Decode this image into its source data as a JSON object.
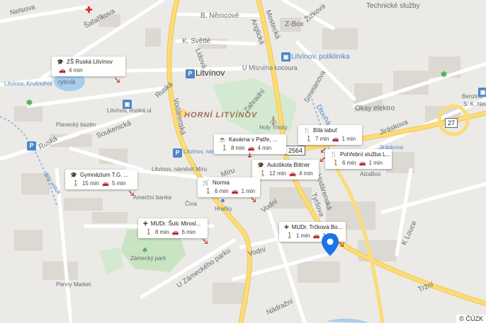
{
  "labels": {
    "nelsova": "Nelsova",
    "safarikova": "Šafaříkova",
    "b_nemcove": "B. Němcové",
    "k_svetle": "K. Světlé",
    "mostecka": "Mostecká",
    "zizkova": "Žižkova",
    "z_box": "Z-Box",
    "technicke_sluzby": "Technické služby",
    "anglicka": "Anglická",
    "litvinov_poliklinika": "Litvínov, poliklinika",
    "u_mlsneho_kocoura": "U Mlsného kocoura",
    "litvinov": "Litvínov",
    "lidova": "Lidová",
    "litvinov_krusnohor": "Litvínov, Krušnohor",
    "rybnik": "rybník",
    "ruska_1": "Ruská",
    "vodarenska_1": "Vodárenská",
    "zahradni": "Zahradní",
    "smetanova": "Smetanova",
    "okay_elektro": "Okay elektro",
    "benzina": "Benzina -",
    "s_k_neum": "S. K. Neum",
    "dlouha": "Dlouhá",
    "litvinov_ruska": "Litvínov, Ruská ul.",
    "plavecky_bazen": "Plavecký bazén",
    "soukenicka": "Soukenická",
    "horni_litvinov": "HORNÍ LITVÍNOV",
    "holy_trinity": "Holy Trinity",
    "jiraskova": "Jiráskova",
    "ruska_2": "Ruská",
    "litvinov_nam": "Litvínov, nám",
    "litvinov_namesti_miru": "Litvínov, náměstí Míru",
    "miru": "Míru",
    "jiraskova_2": "Jiráskova",
    "alzabox": "AlzaBox",
    "ke_potok": "Bílý potok",
    "americni_banka": "Amerční banka",
    "cina": "Čína",
    "hracky": "Hračky",
    "vodni_1": "Vodní",
    "vodarenska_2": "Vodárenská",
    "tyrsova": "Tyršova",
    "k_louce": "K Louce",
    "zamecky_park": "Zámecký park",
    "u_zameckeho_parku": "U Zámeckého parku",
    "vodni_2": "Vodní",
    "penny_market": "Penny Market",
    "nadrazni": "Nádražní",
    "trzni": "Tržní"
  },
  "roads": {
    "r2564": "2564",
    "r27": "27"
  },
  "cards": [
    {
      "title": "ZŠ Ruská Litvínov",
      "icon": "school-icon",
      "walk": "",
      "drive": "4 min"
    },
    {
      "title": "Kavárna v Patře, ...",
      "icon": "cafe-icon",
      "walk": "8 min",
      "drive": "4 min"
    },
    {
      "title": "Bílá labuť",
      "icon": "restaurant-icon",
      "walk": "7 min",
      "drive": "1 min"
    },
    {
      "title": "Pohřební služba L...",
      "icon": "restaurant-icon",
      "walk": "6 min",
      "drive": "1 min"
    },
    {
      "title": "Autoškola Bittner",
      "icon": "school-icon",
      "walk": "12 min",
      "drive": "4 min"
    },
    {
      "title": "Gymnázium T.G. ...",
      "icon": "school-icon",
      "walk": "15 min",
      "drive": "5 min"
    },
    {
      "title": "Norma",
      "icon": "shopping-cart-icon",
      "walk": "6 min",
      "drive": "1 min"
    },
    {
      "title": "MUDr. Šulc Mirosl...",
      "icon": "medical-icon",
      "walk": "8 min",
      "drive": "6 min"
    },
    {
      "title": "MUDr. Trčková Bo...",
      "icon": "medical-icon",
      "walk": "1 min",
      "drive": "1 min"
    }
  ],
  "attribution": "© ČÚZK",
  "colors": {
    "major_road": "#fbdc7a",
    "minor_road": "#ffffff",
    "park": "#c9e4c2",
    "water": "#a7cdef",
    "pin": "#1a73e8",
    "transit": "#4d86c9"
  }
}
